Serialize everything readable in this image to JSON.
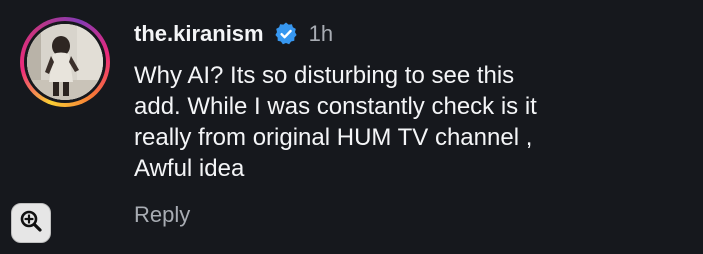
{
  "comment": {
    "username": "the.kiranism",
    "verified": true,
    "timestamp": "1h",
    "lines": [
      "Why AI? Its so disturbing to see this",
      "add. While I was constantly check is it",
      "really from original HUM TV channel ,",
      "Awful idea"
    ],
    "reply_label": "Reply"
  },
  "icons": {
    "verified": "verified-badge-icon",
    "zoom": "zoom-in-icon"
  },
  "colors": {
    "background": "#16181d",
    "text": "#f4f5f7",
    "muted": "#a8acb3",
    "verified": "#3797f0"
  }
}
